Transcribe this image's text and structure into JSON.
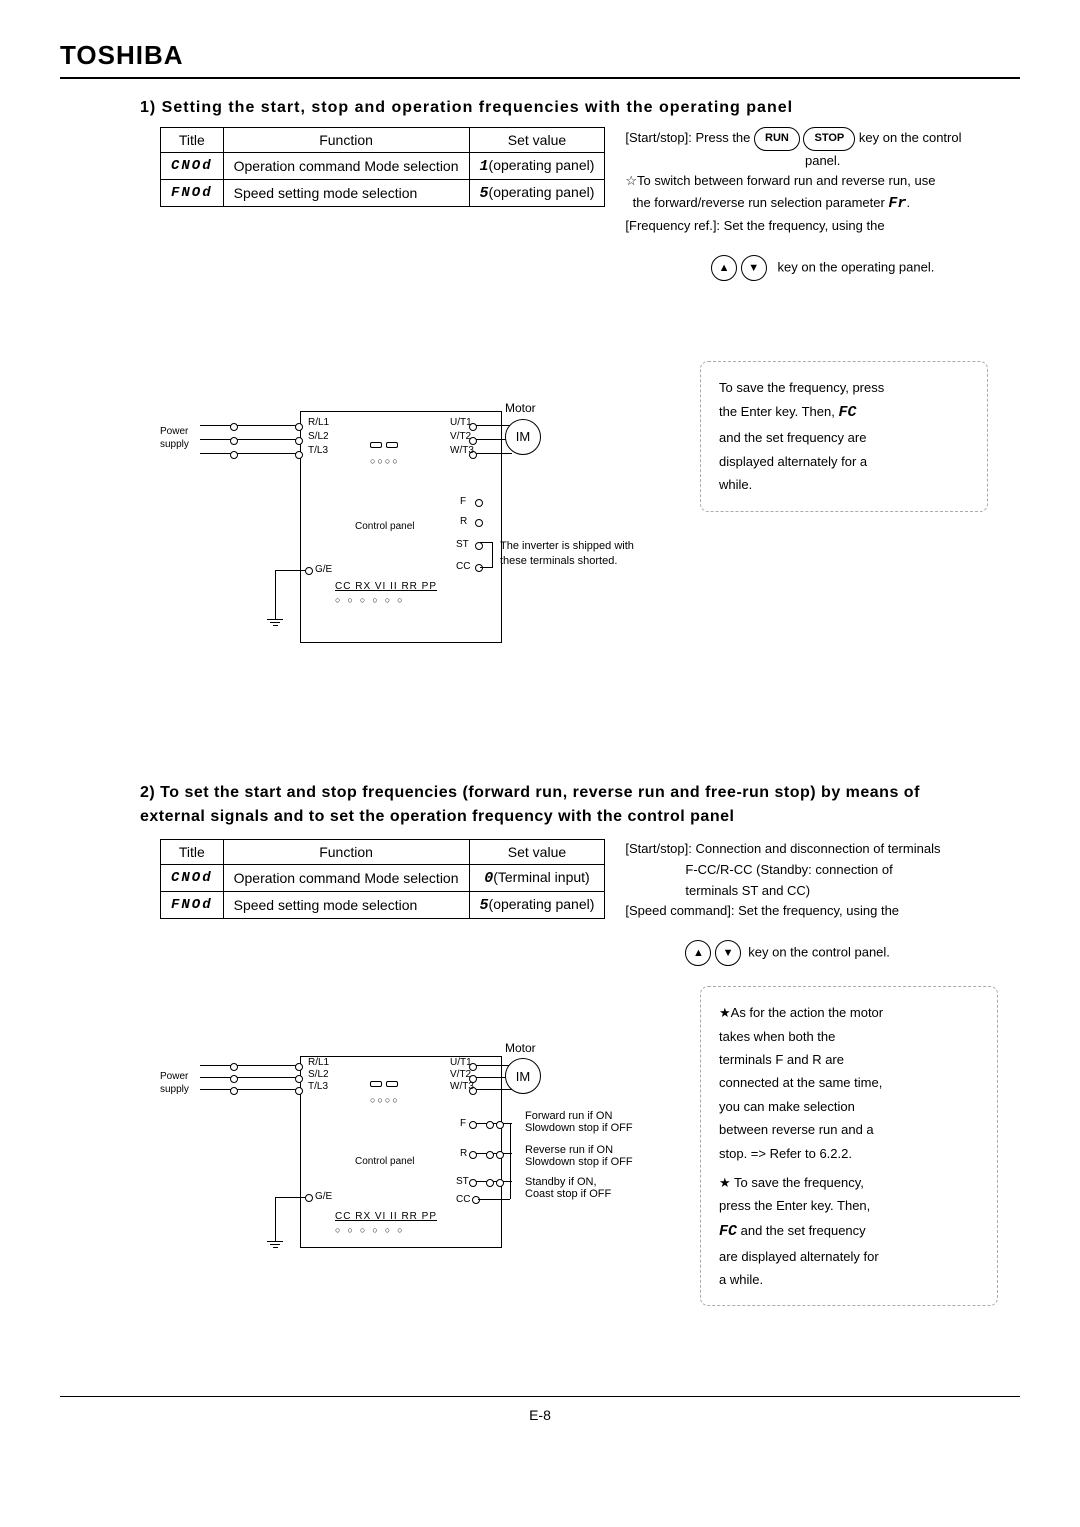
{
  "brand": "TOSHIBA",
  "section1": {
    "title": "1) Setting the start, stop and operation frequencies with the operating panel",
    "table": {
      "headers": [
        "Title",
        "Function",
        "Set value"
      ],
      "rows": [
        {
          "title": "CNOd",
          "function": "Operation command Mode selection",
          "setvalue_prefix": "1",
          "setvalue": "(operating panel)"
        },
        {
          "title": "FNOd",
          "function": "Speed setting mode selection",
          "setvalue_prefix": "5",
          "setvalue": "(operating panel)"
        }
      ]
    },
    "desc": {
      "line1a": "[Start/stop]: Press the ",
      "run": "RUN",
      "stop": "STOP",
      "line1b": " key on the control",
      "line2": "panel.",
      "line3": "☆To switch between forward run and reverse run, use",
      "line4a": "the forward/reverse run selection parameter ",
      "fr": "Fr",
      "line4b": ".",
      "line5": "[Frequency ref.]: Set the frequency, using the",
      "line6": "key on the operating panel."
    },
    "diagram": {
      "motor": "Motor",
      "im": "IM",
      "power": "Power",
      "supply": "supply",
      "r": "R/L1",
      "s": "S/L2",
      "t": "T/L3",
      "u": "U/T1",
      "v": "V/T2",
      "w": "W/T3",
      "F": "F",
      "R": "R",
      "ST": "ST",
      "CC": "CC",
      "GE": "G/E",
      "cp": "Control panel",
      "bottom": "CC RX VI II RR PP",
      "shorted": "The inverter is shipped with these terminals shorted."
    },
    "note": {
      "l1": "To save the frequency, press",
      "l2a": "the Enter key.  Then, ",
      "fc": "FC",
      "l3": "and the set frequency are",
      "l4": "displayed alternately for a",
      "l5": "while."
    }
  },
  "section2": {
    "title": "2) To set the start and stop frequencies (forward run, reverse run and free-run stop) by means of external signals and to set the operation frequency with the control panel",
    "table": {
      "headers": [
        "Title",
        "Function",
        "Set value"
      ],
      "rows": [
        {
          "title": "CNOd",
          "function": "Operation command Mode selection",
          "setvalue_prefix": "0",
          "setvalue": "(Terminal input)"
        },
        {
          "title": "FNOd",
          "function": "Speed setting mode selection",
          "setvalue_prefix": "5",
          "setvalue": "(operating panel)"
        }
      ]
    },
    "desc": {
      "line1": "[Start/stop]: Connection and disconnection of terminals",
      "line2": "F-CC/R-CC (Standby: connection of",
      "line3": "terminals ST and CC)",
      "line4": "[Speed command]: Set the frequency, using the",
      "line5": "key on the control panel."
    },
    "diagram": {
      "motor": "Motor",
      "im": "IM",
      "power": "Power",
      "supply": "supply",
      "r": "R/L1",
      "s": "S/L2",
      "t": "T/L3",
      "u": "U/T1",
      "v": "V/T2",
      "w": "W/T3",
      "F": "F",
      "R": "R",
      "ST": "ST",
      "CC": "CC",
      "GE": "G/E",
      "cp": "Control panel",
      "bottom": "CC RX VI II RR PP",
      "fwd": "Forward run if ON",
      "fwd2": "Slowdown stop if OFF",
      "rev": "Reverse run if ON",
      "rev2": "Slowdown stop if OFF",
      "stb": "Standby if ON,",
      "stb2": "Coast stop if OFF"
    },
    "note": {
      "l1": "★As for the action the motor",
      "l2": "takes when both the",
      "l3": "terminals F and R are",
      "l4": "connected at the same time,",
      "l5": "you can make selection",
      "l6": "between reverse run and a",
      "l7": "stop. => Refer to 6.2.2.",
      "l8": "★ To save the frequency,",
      "l9": "press the Enter key.  Then,",
      "fc": "FC",
      "l10": " and the set frequency",
      "l11": "are displayed alternately for",
      "l12": "a while."
    }
  },
  "pageNumber": "E-8"
}
